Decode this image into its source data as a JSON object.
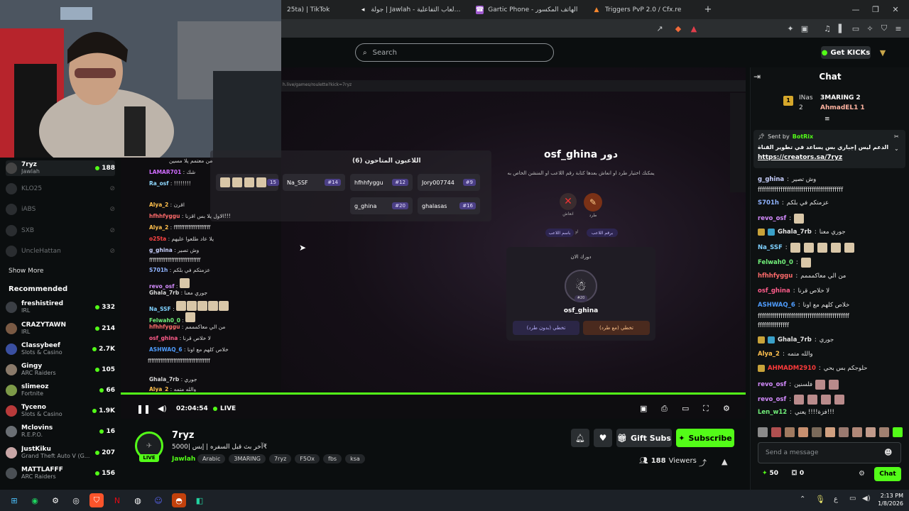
{
  "browser": {
    "tabs": [
      {
        "label": "25ta) | TikTok",
        "icon": "tiktok-icon"
      },
      {
        "label": "جولة | Jawlah - منصة الألعاب التفاعلية",
        "icon": "jawlah-icon"
      },
      {
        "label": "Gartic Phone - لعبة الهاتف المكسور",
        "icon": "gartic-icon"
      },
      {
        "label": "Triggers PvP 2.0 / Cfx.re",
        "icon": "cfx-icon"
      }
    ],
    "new_tab": "+"
  },
  "kick_header": {
    "search_placeholder": "Search",
    "get_kicks": "Get KICKs"
  },
  "sidebar": {
    "following": [
      {
        "name": "7ryz",
        "sub": "Jawlah",
        "viewers": "188",
        "live": true
      },
      {
        "name": "KLO25",
        "sub": "",
        "viewers": "",
        "live": false
      },
      {
        "name": "iABS",
        "sub": "",
        "viewers": "",
        "live": false
      },
      {
        "name": "SXB",
        "sub": "",
        "viewers": "",
        "live": false
      },
      {
        "name": "UncleHattan",
        "sub": "",
        "viewers": "",
        "live": false
      }
    ],
    "show_more": "Show More",
    "recommended_title": "Recommended",
    "recommended": [
      {
        "name": "freshistired",
        "sub": "IRL",
        "viewers": "332"
      },
      {
        "name": "CRAZYTAWN",
        "sub": "IRL",
        "viewers": "214"
      },
      {
        "name": "Classybeef",
        "sub": "Slots & Casino",
        "viewers": "2.7K"
      },
      {
        "name": "Gingy",
        "sub": "ARC Raiders",
        "viewers": "105"
      },
      {
        "name": "slimeoz",
        "sub": "Fortnite",
        "viewers": "66"
      },
      {
        "name": "Tyceno",
        "sub": "Slots & Casino",
        "viewers": "1.9K"
      },
      {
        "name": "Mclovins",
        "sub": "R.E.P.O.",
        "viewers": "16"
      },
      {
        "name": "JustKiku",
        "sub": "Grand Theft Auto V (G...",
        "viewers": "207"
      },
      {
        "name": "MATTLAFFF",
        "sub": "ARC Raiders",
        "viewers": "156"
      }
    ]
  },
  "game": {
    "url": "h.live/games/roulette?kick=7ryz",
    "players_title": "اللاعبون المتاحون (6)",
    "players": [
      {
        "name": "Na_SSF",
        "rank": "#14"
      },
      {
        "name": "hfhhfyggu",
        "rank": "#12"
      },
      {
        "name": "Jory007744",
        "rank": "#9"
      },
      {
        "name": "g_ghina",
        "rank": "#20"
      },
      {
        "name": "ghalasas",
        "rank": "#16"
      }
    ],
    "partial_rank": "15",
    "turn_title": "دور osf_ghina",
    "turn_desc": "يمكنك اختيار طرد او انعاش بعدها كتابة رقم اللاعب او المنشن الخاص به",
    "action_revive": "انعاش",
    "action_kick": "طرد",
    "hint_a": "باسم اللاعب",
    "hint_or": "او",
    "hint_b": "برقم اللاعب",
    "your_turn": "دورك الان",
    "current_player": "osf_ghina",
    "current_rank": "#20",
    "skip_no_kick": "تخطي (بدون طرد)",
    "skip_with_kick": "تخطي (مع طرد)"
  },
  "overlay_chat": [
    {
      "user": "",
      "text": "من معتمم يلا مسين"
    },
    {
      "user": "LAMAR701",
      "text": "شك"
    },
    {
      "user": "Ra_osf",
      "text": "!!!!!!!!"
    },
    {
      "user": "Alya_2",
      "text": "اقرن"
    },
    {
      "user": "hfhhfyggu",
      "text": "الاول يلا بس اقزنا!!!"
    },
    {
      "user": "Alya_2",
      "text": "ffffffffffffffffffff"
    },
    {
      "user": "o25ta",
      "text": "يلا عاد طلعوا عليهم"
    },
    {
      "user": "g_ghina",
      "text": "وش تصير"
    },
    {
      "user": "",
      "text": "ffffffffffffffffffffffffffff"
    },
    {
      "user": "S701h",
      "text": "عزمتكم في بلكم"
    },
    {
      "user": "revo_osf",
      "text": ""
    },
    {
      "user": "Ghala_7rb",
      "text": "جوري معنا"
    },
    {
      "user": "Na_SSF",
      "text": ""
    },
    {
      "user": "Felwah0_0",
      "text": ""
    },
    {
      "user": "hfhhfyggu",
      "text": "من الي معاكمممم"
    },
    {
      "user": "osf_ghina",
      "text": "لا خلاص قرنا"
    },
    {
      "user": "ASHWAQ_6",
      "text": "خلاص كلهم مع اونا"
    },
    {
      "user": "",
      "text": "ffffffffffffffffffffffffffffffffff"
    },
    {
      "user": "Ghala_7rb",
      "text": "جوري"
    },
    {
      "user": "Alya_2",
      "text": "والله متمه"
    }
  ],
  "player_controls": {
    "time": "02:04:54",
    "live_label": "LIVE"
  },
  "stream": {
    "streamer": "7ryz",
    "title": "آخر بث قبل السفره | إبس |5000₹",
    "category": "Jawlah",
    "tags": [
      "Arabic",
      "3MARING",
      "7ryz",
      "F5Ox",
      "fbs",
      "ksa"
    ],
    "live_badge": "LIVE",
    "gift_subs": "Gift Subs",
    "subscribe": "Subscribe",
    "viewers": "188",
    "viewers_label": "Viewers"
  },
  "chat": {
    "title": "Chat",
    "top_gifters": [
      {
        "name": "INas",
        "rank": "1"
      },
      {
        "name": "3MARING",
        "count": "2"
      },
      {
        "name": "AhmadEL1",
        "count": "1"
      }
    ],
    "rank2": "2",
    "pinned_by_label": "Sent by",
    "pinned_by": "BotRix",
    "pinned_text": "الدعم ليس إجباري بس يساعد في تطوير القناة",
    "pinned_link": "https://creators.sa/7ryz",
    "messages": [
      {
        "user": "g_ghina",
        "color": "#c9d1ff",
        "text": "وش تصير"
      },
      {
        "user": "",
        "color": "#ffffff",
        "text": "fffffffffffffffffffffffffffffffffffffffff"
      },
      {
        "user": "S701h",
        "color": "#8fb3ff",
        "text": "عزمتكم في بلكم"
      },
      {
        "user": "revo_osf",
        "color": "#d58cff",
        "text": ""
      },
      {
        "user": "Ghala_7rb",
        "color": "#ffffff",
        "text": "جوري معنا"
      },
      {
        "user": "Na_SSF",
        "color": "#7fd1ff",
        "text": ""
      },
      {
        "user": "Felwah0_0",
        "color": "#72f07a",
        "text": ""
      },
      {
        "user": "hfhhfyggu",
        "color": "#ff6b6b",
        "text": "من الي معاكمممم"
      },
      {
        "user": "osf_ghina",
        "color": "#ff5c8a",
        "text": "لا خلاص قرنا"
      },
      {
        "user": "ASHWAQ_6",
        "color": "#4f9dff",
        "text": "خلاص كلهم مع اونا"
      },
      {
        "user": "",
        "color": "#ffffff",
        "text": "ffffffffffffffffffffffffffffffffffffffffffff"
      },
      {
        "user": "",
        "color": "#ffffff",
        "text": "fffffffffffffff"
      },
      {
        "user": "Ghala_7rb",
        "color": "#ffffff",
        "text": "جوري"
      },
      {
        "user": "Alya_2",
        "color": "#ffc04d",
        "text": "والله متمه"
      },
      {
        "user": "AHMADM2910",
        "color": "#ff3b3b",
        "text": "حلوجكم بس بحي"
      },
      {
        "user": "revo_osf",
        "color": "#d58cff",
        "text": "فلسنين"
      },
      {
        "user": "revo_osf",
        "color": "#d58cff",
        "text": ""
      },
      {
        "user": "Len_w12",
        "color": "#72f07a",
        "text": "فزة!!!! يعني!!!"
      }
    ],
    "input_placeholder": "Send a message",
    "points": "50",
    "gifts_count": "0",
    "send": "Chat"
  },
  "taskbar": {
    "lang": "ع",
    "time": "2:13 PM",
    "date": "1/8/2026"
  },
  "colors": {
    "kick_green": "#53fc18",
    "bg": "#0b0e0f"
  }
}
